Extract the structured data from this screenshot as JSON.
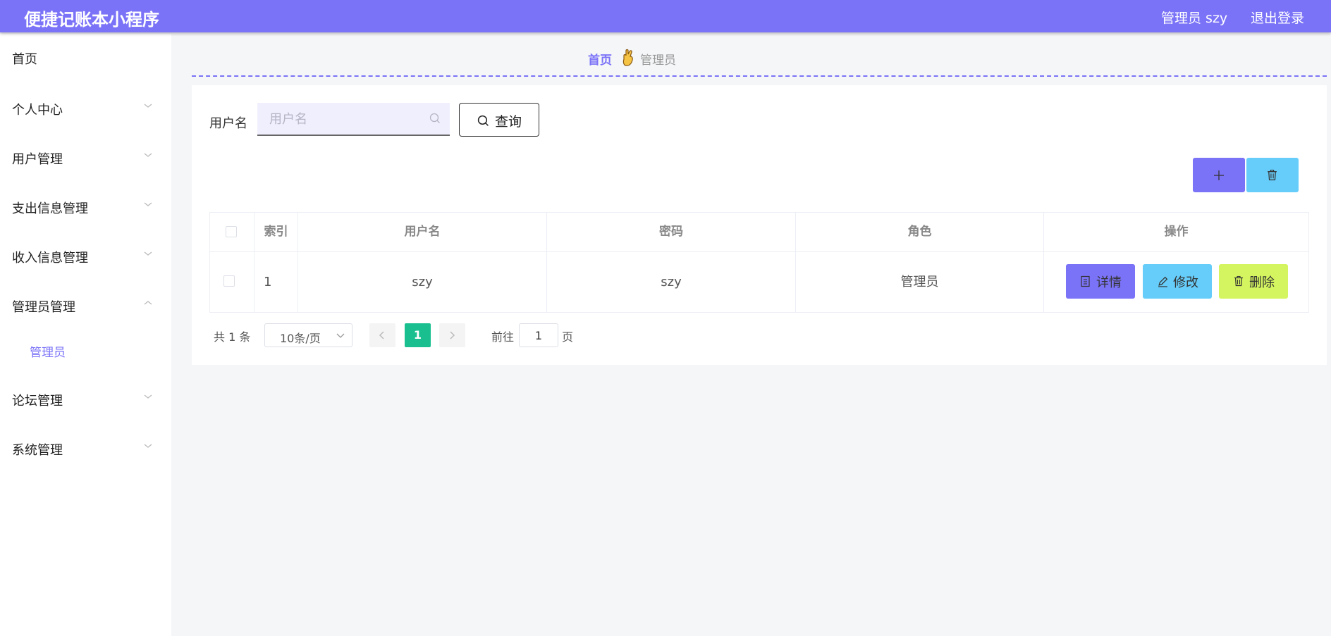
{
  "header": {
    "title": "便捷记账本小程序",
    "user_label": "管理员 szy",
    "logout_label": "退出登录"
  },
  "sidebar": {
    "items": [
      {
        "label": "首页"
      },
      {
        "label": "个人中心"
      },
      {
        "label": "用户管理"
      },
      {
        "label": "支出信息管理"
      },
      {
        "label": "收入信息管理"
      },
      {
        "label": "管理员管理",
        "expanded": true
      },
      {
        "label": "论坛管理"
      },
      {
        "label": "系统管理"
      }
    ],
    "active_sub_item": "管理员"
  },
  "breadcrumb": {
    "home": "首页",
    "current": "管理员"
  },
  "search": {
    "label": "用户名",
    "placeholder": "用户名",
    "button_label": "查询"
  },
  "table": {
    "headers": [
      "索引",
      "用户名",
      "密码",
      "角色",
      "操作"
    ],
    "rows": [
      {
        "index": "1",
        "username": "szy",
        "password": "szy",
        "role": "管理员"
      }
    ],
    "actions": {
      "detail": "详情",
      "edit": "修改",
      "delete": "删除"
    }
  },
  "pagination": {
    "total": "共 1 条",
    "page_size": "10条/页",
    "current_page": "1",
    "goto_prefix": "前往",
    "goto_value": "1",
    "goto_suffix": "页"
  },
  "colors": {
    "primary": "#7b73f7",
    "info": "#66cdfa",
    "danger_lime": "#d4f55f",
    "page_active": "#19bf8f"
  }
}
